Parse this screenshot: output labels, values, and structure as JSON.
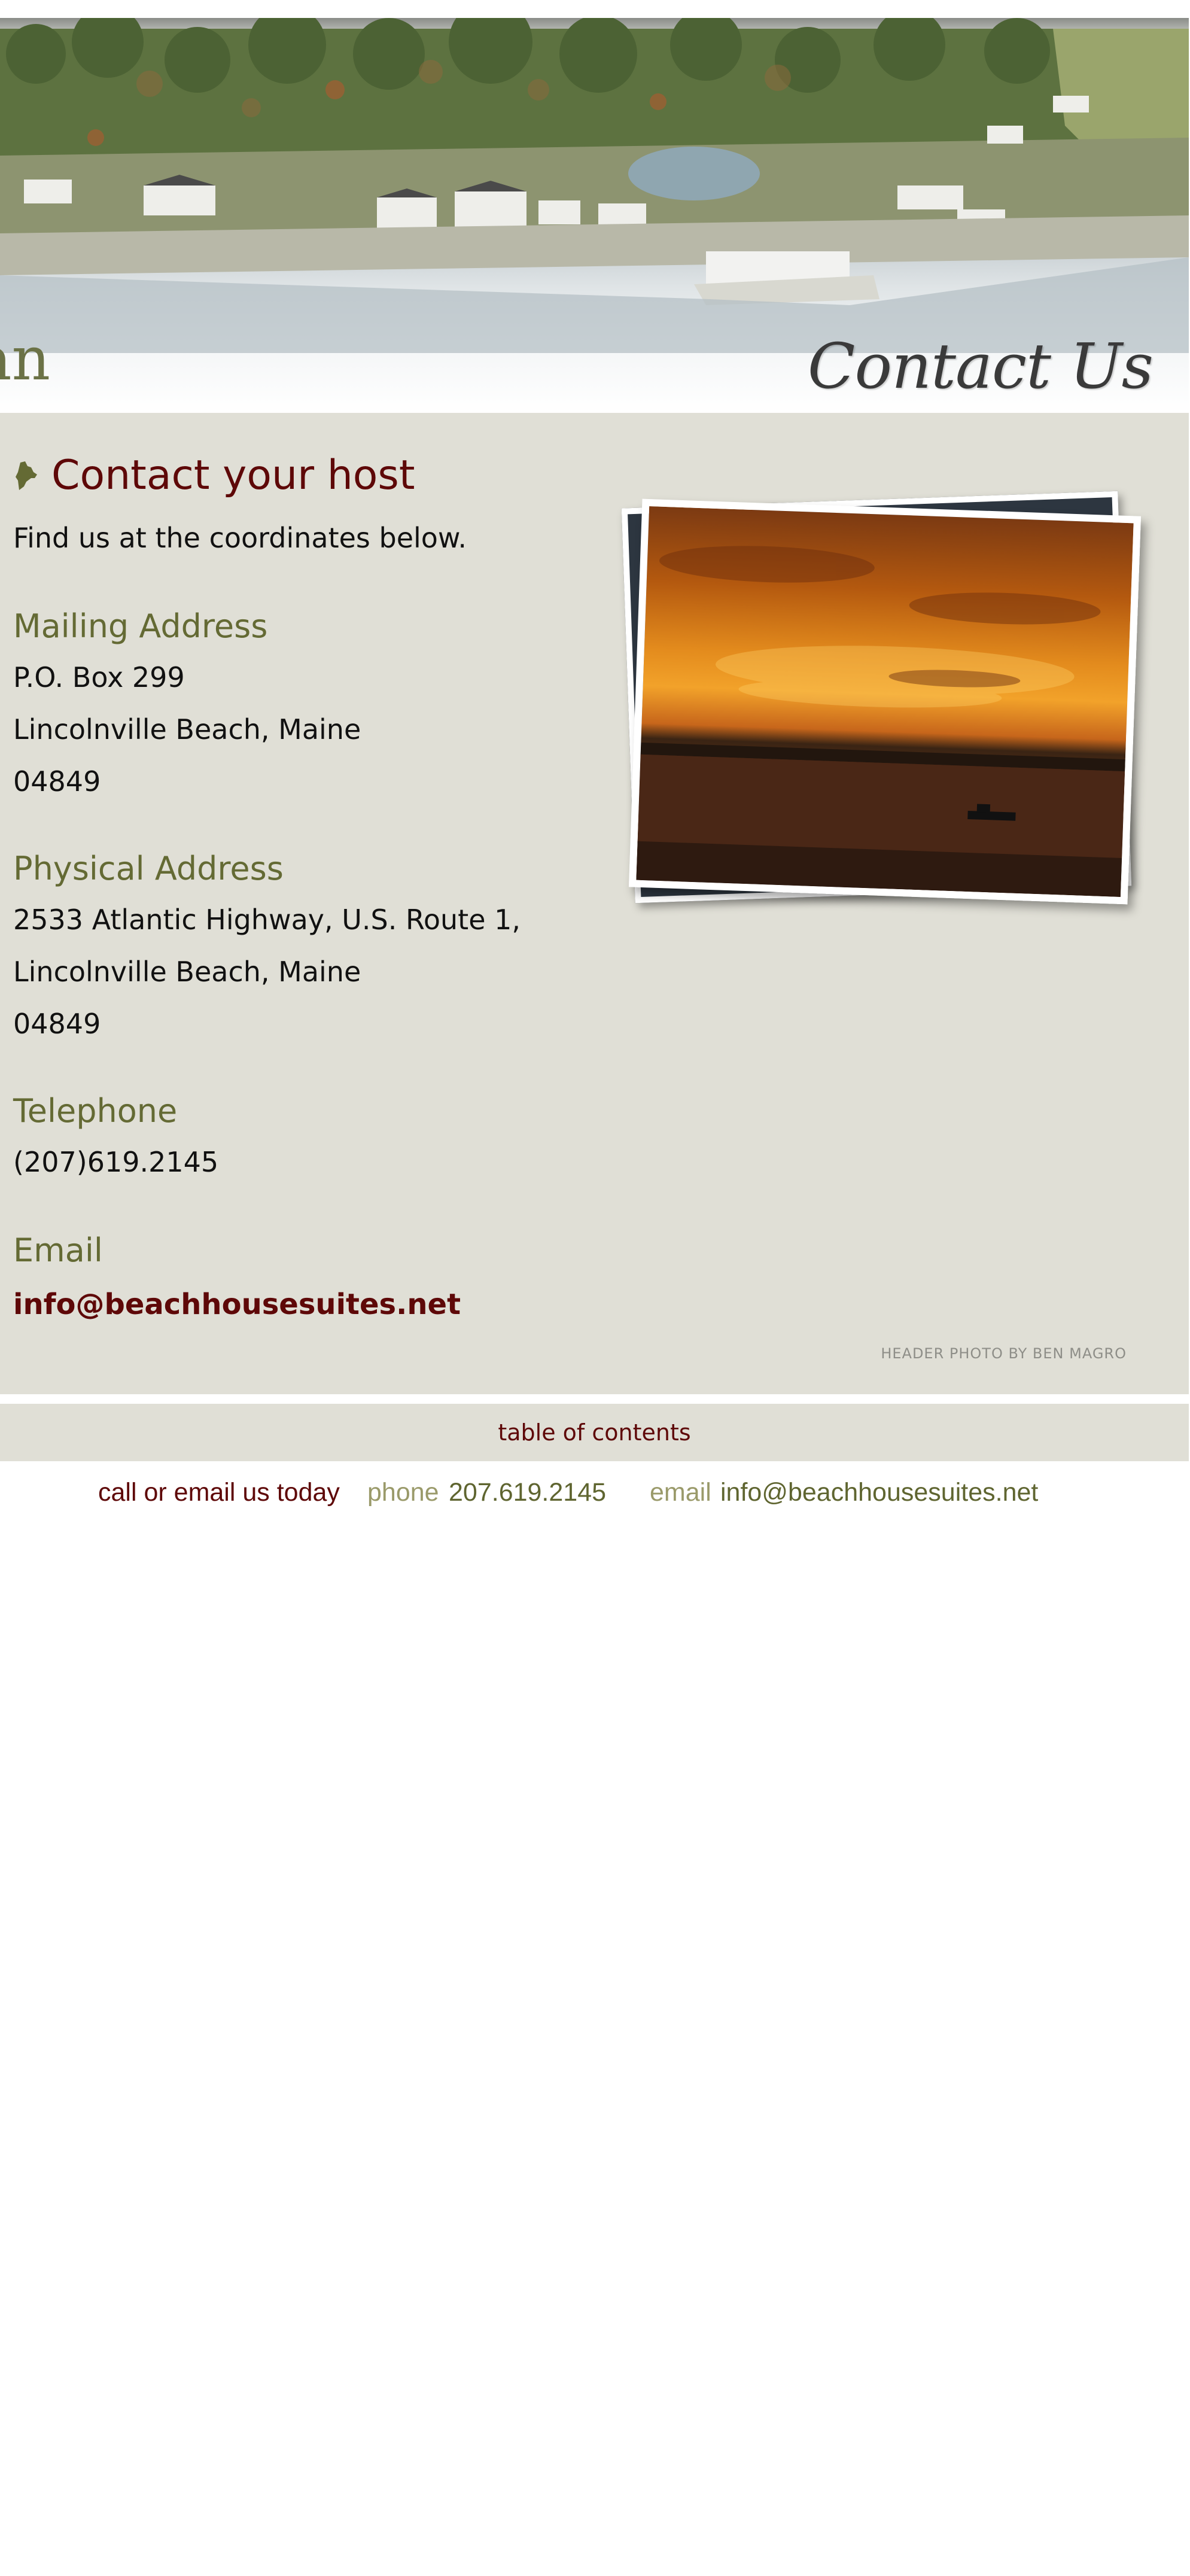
{
  "header": {
    "partial_word": "an",
    "title": "Contact Us"
  },
  "content": {
    "heading": "Contact your host",
    "intro": "Find us at the coordinates below.",
    "mailing": {
      "title": "Mailing Address",
      "line1": "P.O. Box 299",
      "line2": "Lincolnville Beach, Maine",
      "line3": "04849"
    },
    "physical": {
      "title": "Physical Address",
      "line1": "2533 Atlantic Highway, U.S. Route 1,",
      "line2": "Lincolnville Beach, Maine",
      "line3": "04849"
    },
    "telephone": {
      "title": "Telephone",
      "value": "(207)619.2145"
    },
    "email": {
      "title": "Email",
      "value": "info@beachhousesuites.net"
    },
    "photo_credit": "HEADER PHOTO BY BEN MAGRO"
  },
  "footer": {
    "toc_link": "table of contents",
    "cta": "call or email us today",
    "phone_label": "phone",
    "phone_value": "207.619.2145",
    "email_label": "email",
    "email_value": "info@beachhousesuites.net"
  },
  "icons": {
    "title_icon": "maine-state-icon"
  },
  "colors": {
    "heading": "#5e0808",
    "section_title": "#646a34",
    "panel_bg": "#e0dfd6",
    "footer_label": "#9a9a6a",
    "footer_value": "#5f6530"
  }
}
